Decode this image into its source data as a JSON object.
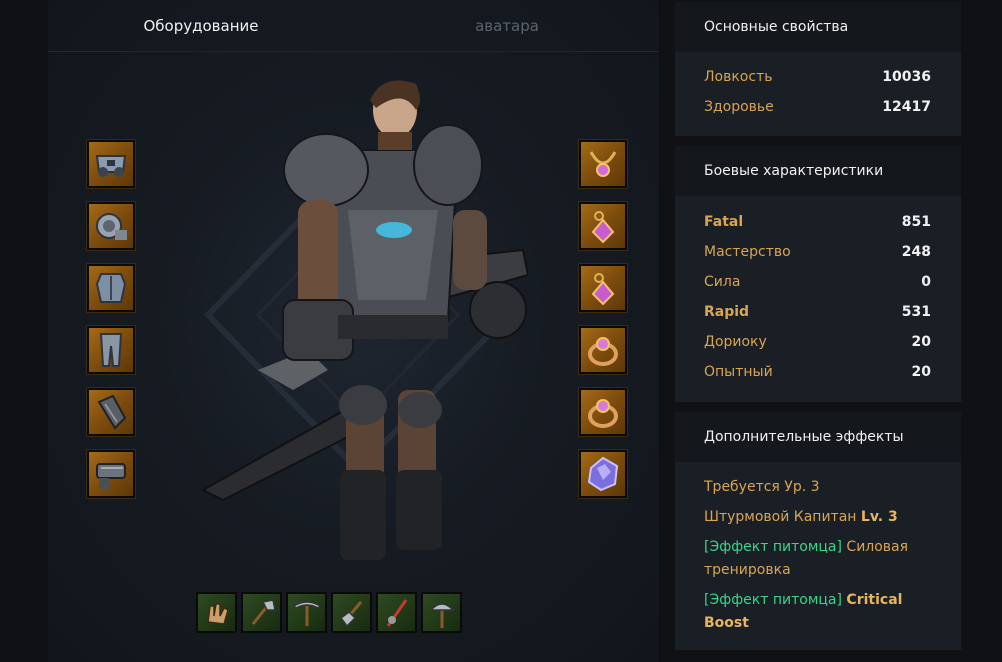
{
  "tabs": {
    "equipment": "Оборудование",
    "avatar": "аватара"
  },
  "left_slots": [
    {
      "icon": "mask-icon"
    },
    {
      "icon": "shoulder-armor-icon"
    },
    {
      "icon": "chest-armor-icon"
    },
    {
      "icon": "leg-armor-icon"
    },
    {
      "icon": "gauntlet-icon"
    },
    {
      "icon": "weapon-icon"
    }
  ],
  "right_slots": [
    {
      "icon": "necklace-icon"
    },
    {
      "icon": "earring-icon"
    },
    {
      "icon": "earring-icon"
    },
    {
      "icon": "ring-icon"
    },
    {
      "icon": "ring-icon"
    },
    {
      "icon": "crystal-stone-icon"
    }
  ],
  "bottom_slots": [
    {
      "icon": "gloves-tool-icon"
    },
    {
      "icon": "axe-icon"
    },
    {
      "icon": "pickaxe-icon"
    },
    {
      "icon": "shovel-icon"
    },
    {
      "icon": "fishing-rod-icon"
    },
    {
      "icon": "hoe-icon"
    }
  ],
  "basic_stats": {
    "title": "Основные свойства",
    "rows": [
      {
        "label": "Ловкость",
        "value": "10036"
      },
      {
        "label": "Здоровье",
        "value": "12417"
      }
    ]
  },
  "combat_stats": {
    "title": "Боевые характеристики",
    "rows": [
      {
        "label": "Fatal",
        "value": "851"
      },
      {
        "label": "Мастерство",
        "value": "248"
      },
      {
        "label": "Сила",
        "value": "0"
      },
      {
        "label": "Rapid",
        "value": "531"
      },
      {
        "label": "Дориоку",
        "value": "20"
      },
      {
        "label": "Опытный",
        "value": "20"
      }
    ]
  },
  "extra_effects": {
    "title": "Дополнительные эффекты",
    "required_level": "Требуется Ур. 3",
    "storm_captain": "Штурмовой Капитан",
    "storm_captain_level": "Lv. 3",
    "pet1_tag": "[Эффект питомца]",
    "pet1_text": "Силовая тренировка",
    "pet2_tag": "[Эффект питомца]",
    "pet2_text": "Critical Boost"
  },
  "colors": {
    "stat_label": "#d9a552",
    "pet_tag": "#37d58a",
    "accent_bar": "#6a3fb5",
    "slot_orange": "#a46a17",
    "slot_green": "#2f4a22"
  }
}
